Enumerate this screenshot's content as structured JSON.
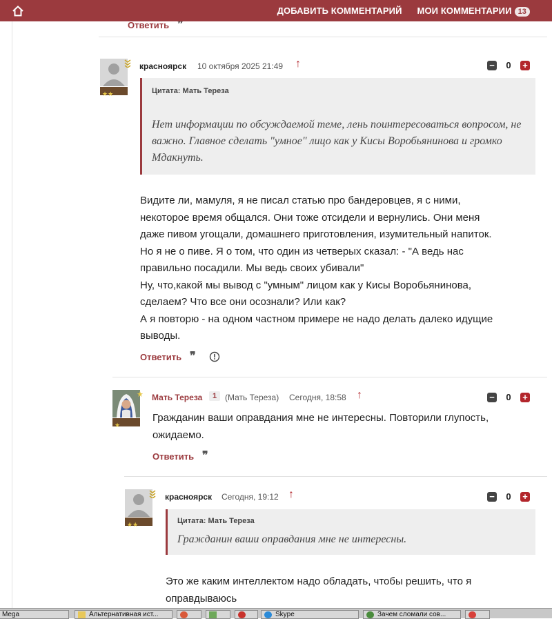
{
  "topbar": {
    "add_comment": "ДОБАВИТЬ КОММЕНТАРИЙ",
    "my_comments": "МОИ КОММЕНТАРИИ",
    "my_comments_count": "13"
  },
  "previous": {
    "reply_label": "Ответить"
  },
  "comment1": {
    "author": "красноярск",
    "timestamp": "10 октября 2025 21:49",
    "votes": "0",
    "quote_header": "Цитата: Мать Тереза",
    "quote_text": "Нет информации по обсуждаемой теме, лень поинтересоваться вопросом, не важно. Главное сделать \"умное\" лицо как у Кисы Воробьянинова и громко Мдакнуть.",
    "body_lines": [
      "Видите ли, мамуля, я не писал статью про бандеровцев, я с ними,",
      "некоторое время общался. Они тоже отсидели и вернулись. Они меня",
      "даже пивом угощали, домашнего приготовления, изумительный напиток.",
      "Но я не о пиве. Я о том, что один из четверых сказал: - \"А ведь нас",
      "правильно посадили. Мы ведь своих убивали\"",
      "Ну, что,какой мы вывод с \"умным\" лицом как у Кисы Воробьянинова,",
      "сделаем? Что все они осознали? Или как?",
      "А я повторю - на одном частном примере не надо делать далеко идущие",
      "выводы."
    ],
    "reply_label": "Ответить"
  },
  "comment2": {
    "author": "Мать Тереза",
    "level_badge": "1",
    "alias": "(Мать Тереза)",
    "timestamp": "Сегодня, 18:58",
    "votes": "0",
    "body": "Гражданин ваши оправдания мне не интересны. Повторили глупость, ожидаемо.",
    "reply_label": "Ответить"
  },
  "comment3": {
    "author": "красноярск",
    "timestamp": "Сегодня, 19:12",
    "votes": "0",
    "quote_header": "Цитата: Мать Тереза",
    "quote_text": "Гражданин ваши оправдания мне не интересны.",
    "body_lines": [
      "Это же каким интеллектом надо обладать, чтобы решить, что я",
      "оправдываюсь"
    ]
  },
  "taskbar": {
    "items": [
      "Mega",
      "Альтернативная ист...",
      "",
      "",
      "",
      "Skype",
      "Зачем сломали сов...",
      ""
    ]
  },
  "colors": {
    "brand": "#9b3a3e",
    "plus": "#b3262c",
    "minus": "#444444"
  }
}
